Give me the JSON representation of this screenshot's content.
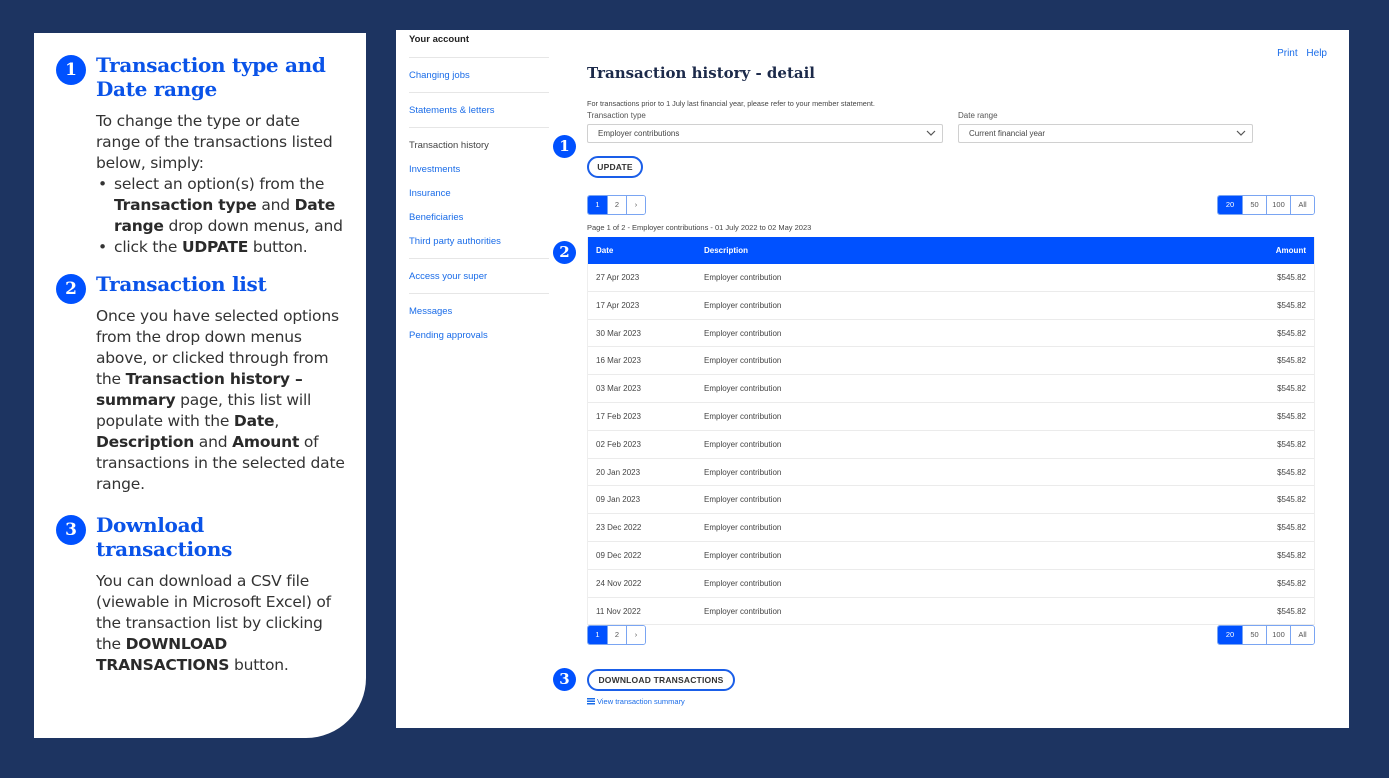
{
  "colors": {
    "background": "#1d3461",
    "accent": "#0051ff",
    "link": "#1a6ce8",
    "heading": "#1c2a4a"
  },
  "guide": {
    "sections": [
      {
        "number": "1",
        "title": "Transaction type and Date range",
        "intro": "To change the type or date range of the transactions listed below, simply:",
        "bullets": [
          {
            "pre": "select an option(s) from the ",
            "b1": "Transaction type",
            "mid": " and ",
            "b2": "Date range",
            "post": " drop down menus, and"
          },
          {
            "pre": "click the ",
            "b1": "UDPATE",
            "post": " button."
          }
        ]
      },
      {
        "number": "2",
        "title": "Transaction list",
        "p1": "Once you have selected options from the drop down menus above, or clicked through from the ",
        "b1": "Transaction history – summary",
        "p2": " page, this list will populate with the ",
        "b2": "Date",
        "p3": ", ",
        "b3": "Description",
        "p4": " and ",
        "b4": "Amount",
        "p5": " of transactions in the selected date range."
      },
      {
        "number": "3",
        "title": "Download transactions",
        "p1": "You can download a CSV file (viewable in Microsoft Excel) of the transaction list by clicking the ",
        "b1": "DOWNLOAD TRANSACTIONS",
        "p2": " button."
      }
    ]
  },
  "app": {
    "sidebar": {
      "heading": "Your account",
      "groups": [
        [
          "Changing jobs"
        ],
        [
          "Statements & letters"
        ],
        [
          "Transaction history",
          "Investments",
          "Insurance",
          "Beneficiaries",
          "Third party authorities"
        ],
        [
          "Access your super"
        ],
        [
          "Messages",
          "Pending approvals"
        ]
      ],
      "current": "Transaction history"
    },
    "top_links": {
      "print": "Print",
      "help": "Help"
    },
    "page_title": "Transaction history - detail",
    "note": "For transactions prior to 1 July last financial year, please refer to your member statement.",
    "filters": {
      "transaction_type": {
        "label": "Transaction type",
        "value": "Employer contributions"
      },
      "date_range": {
        "label": "Date range",
        "value": "Current financial year"
      }
    },
    "update_label": "UPDATE",
    "pagination": {
      "pages": [
        "1",
        "2",
        "›"
      ],
      "current": "1"
    },
    "page_sizes": {
      "options": [
        "20",
        "50",
        "100",
        "All"
      ],
      "current": "20"
    },
    "page_caption": "Page 1 of 2 - Employer contributions - 01 July 2022 to 02 May 2023",
    "table": {
      "headers": {
        "date": "Date",
        "description": "Description",
        "amount": "Amount"
      },
      "rows": [
        {
          "date": "27 Apr 2023",
          "description": "Employer contribution",
          "amount": "$545.82"
        },
        {
          "date": "17 Apr 2023",
          "description": "Employer contribution",
          "amount": "$545.82"
        },
        {
          "date": "30 Mar 2023",
          "description": "Employer contribution",
          "amount": "$545.82"
        },
        {
          "date": "16 Mar 2023",
          "description": "Employer contribution",
          "amount": "$545.82"
        },
        {
          "date": "03 Mar 2023",
          "description": "Employer contribution",
          "amount": "$545.82"
        },
        {
          "date": "17 Feb 2023",
          "description": "Employer contribution",
          "amount": "$545.82"
        },
        {
          "date": "02 Feb 2023",
          "description": "Employer contribution",
          "amount": "$545.82"
        },
        {
          "date": "20 Jan 2023",
          "description": "Employer contribution",
          "amount": "$545.82"
        },
        {
          "date": "09 Jan 2023",
          "description": "Employer contribution",
          "amount": "$545.82"
        },
        {
          "date": "23 Dec 2022",
          "description": "Employer contribution",
          "amount": "$545.82"
        },
        {
          "date": "09 Dec 2022",
          "description": "Employer contribution",
          "amount": "$545.82"
        },
        {
          "date": "24 Nov 2022",
          "description": "Employer contribution",
          "amount": "$545.82"
        },
        {
          "date": "11 Nov 2022",
          "description": "Employer contribution",
          "amount": "$545.82"
        }
      ]
    },
    "download_label": "DOWNLOAD TRANSACTIONS",
    "summary_link": "View transaction summary",
    "callouts": [
      "1",
      "2",
      "3"
    ]
  }
}
